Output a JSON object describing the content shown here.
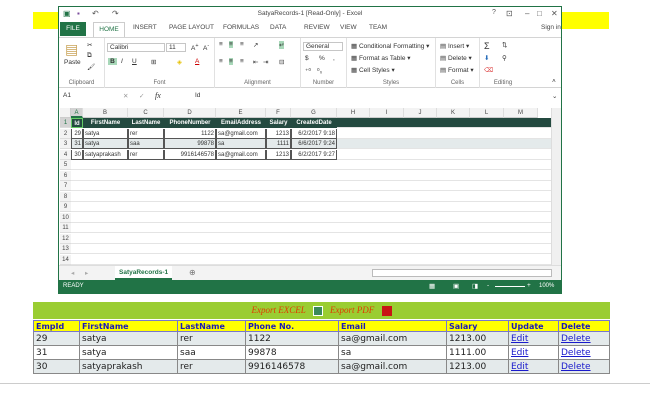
{
  "window": {
    "title": "SatyaRecords-1  [Read-Only] - Excel",
    "help": "?",
    "sign_in": "Sign in"
  },
  "tabs": [
    "FILE",
    "HOME",
    "INSERT",
    "PAGE LAYOUT",
    "FORMULAS",
    "DATA",
    "REVIEW",
    "VIEW",
    "TEAM"
  ],
  "ribbon": {
    "paste": "Paste",
    "font_name": "Calibri",
    "font_size": "11",
    "bold": "B",
    "italic": "I",
    "underline": "U",
    "number_format": "General",
    "currency": "$",
    "percent": "%",
    "comma": ",",
    "conditional_formatting": "Conditional Formatting",
    "format_as_table": "Format as Table",
    "cell_styles": "Cell Styles",
    "insert": "Insert",
    "delete": "Delete",
    "format": "Format",
    "groups": [
      "Clipboard",
      "Font",
      "Alignment",
      "Number",
      "Styles",
      "Cells",
      "Editing"
    ]
  },
  "formula_bar": {
    "name_box": "A1",
    "fx": "fx",
    "value": "Id"
  },
  "sheet": {
    "columns": [
      "A",
      "B",
      "C",
      "D",
      "E",
      "F",
      "G",
      "H",
      "I",
      "J",
      "K",
      "L",
      "M"
    ],
    "row_numbers": [
      "1",
      "2",
      "3",
      "4",
      "5",
      "6",
      "7",
      "8",
      "9",
      "10",
      "11",
      "12",
      "13",
      "14"
    ],
    "header": [
      "Id",
      "FirstName",
      "LastName",
      "PhoneNumber",
      "EmailAddress",
      "Salary",
      "CreatedDate"
    ],
    "rows": [
      [
        "29",
        "satya",
        "rer",
        "1122",
        "sa@gmail.com",
        "1213",
        "6/2/2017 9:18"
      ],
      [
        "31",
        "satya",
        "saa",
        "99878",
        "sa",
        "1111",
        "6/6/2017 9:24"
      ],
      [
        "30",
        "satyaprakash",
        "rer",
        "9916146578",
        "sa@gmail.com",
        "1213",
        "6/2/2017 9:27"
      ]
    ],
    "header_color": "#244a40"
  },
  "sheet_tab": "SatyaRecords-1",
  "status": {
    "ready": "READY",
    "zoom": "100%"
  },
  "export": {
    "excel": "Export EXCEL",
    "pdf": "Export PDF"
  },
  "grid": {
    "headers": [
      "EmpId",
      "FirstName",
      "LastName",
      "Phone No.",
      "Email",
      "Salary",
      "Update",
      "Delete"
    ],
    "rows": [
      {
        "id": "29",
        "first": "satya",
        "last": "rer",
        "phone": "1122",
        "email": "sa@gmail.com",
        "salary": "1213.00",
        "edit": "Edit",
        "delete": "Delete"
      },
      {
        "id": "31",
        "first": "satya",
        "last": "saa",
        "phone": "99878",
        "email": "sa",
        "salary": "1111.00",
        "edit": "Edit",
        "delete": "Delete"
      },
      {
        "id": "30",
        "first": "satyaprakash",
        "last": "rer",
        "phone": "9916146578",
        "email": "sa@gmail.com",
        "salary": "1213.00",
        "edit": "Edit",
        "delete": "Delete"
      }
    ]
  }
}
